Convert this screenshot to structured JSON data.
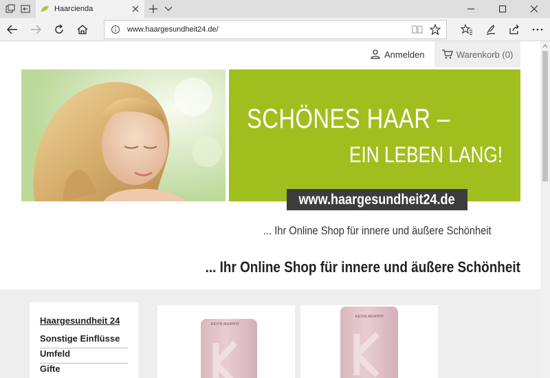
{
  "browser": {
    "tab_title": "Haarcienda",
    "url": "www.haargesundheit24.de/",
    "icons": [
      "tab-actions-icon",
      "set-aside-tabs-icon",
      "leaf-favicon-icon",
      "close-tab-icon",
      "new-tab-icon",
      "tab-menu-icon",
      "minimize-icon",
      "maximize-icon",
      "window-close-icon",
      "back-icon",
      "forward-icon",
      "refresh-icon",
      "home-icon",
      "info-icon",
      "reading-view-icon",
      "favorite-star-icon",
      "favorites-hub-icon",
      "pen-icon",
      "share-icon",
      "more-icon"
    ]
  },
  "account": {
    "login_label": "Anmelden",
    "cart_label": "Warenkorb (0)"
  },
  "banner": {
    "headline_line1": "SCHÖNES HAAR –",
    "headline_line2": "EIN LEBEN LANG!",
    "url_text": "www.haargesundheit24.de",
    "tagline": "... Ihr Online Shop für innere und äußere Schönheit"
  },
  "page": {
    "heading": "... Ihr Online Shop für innere und äußere Schönheit"
  },
  "sidebar": {
    "title": "Haargesundheit 24",
    "items": [
      {
        "label": "Sonstige Einflüsse"
      },
      {
        "label": "Umfeld"
      },
      {
        "label": "Gifte"
      }
    ]
  },
  "products": [
    {
      "brand": "KEVIN.MURPHY"
    },
    {
      "brand": "KEVIN.MURPHY"
    }
  ],
  "colors": {
    "banner_green": "#a0bf1e",
    "url_box": "#3d3d3d",
    "content_bg": "#eeeeee"
  }
}
